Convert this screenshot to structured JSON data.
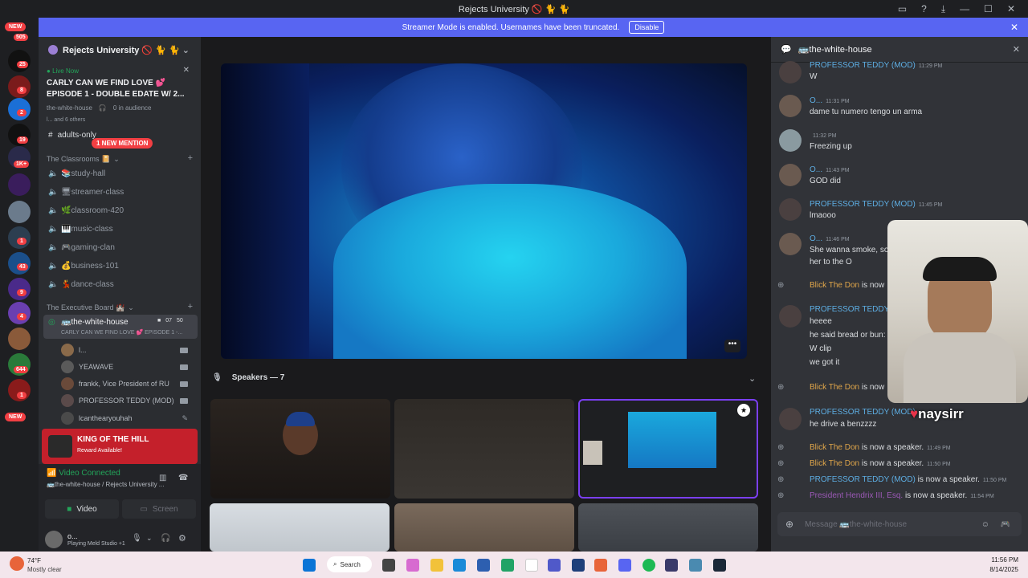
{
  "window": {
    "title": "Rejects University 🚫 🐈 🐈",
    "icons": [
      "inbox-icon",
      "help-icon",
      "download-icon",
      "minimize-icon",
      "maximize-icon",
      "close-icon"
    ]
  },
  "banner": {
    "text": "Streamer Mode is enabled. Usernames have been truncated.",
    "button": "Disable"
  },
  "rail": {
    "top_badge": "NEW",
    "top_count": "505",
    "badges": [
      "25",
      "8",
      "2",
      "19",
      "1K+",
      "1",
      "43",
      "9",
      "4",
      "644",
      "1"
    ],
    "bottom_badge": "NEW"
  },
  "sidebar": {
    "server_name": "Rejects University 🚫 🐈 🐈",
    "live": {
      "status": "Live Now",
      "title_line1": "CARLY CAN WE FIND LOVE 💕",
      "title_line2": "EPISODE 1 - DOUBLE EDATE W/ 2...",
      "channel": "the-white-house",
      "audience": "0 in audience",
      "others": "l... and 6 others"
    },
    "adults_channel": "adults-only",
    "mention_badge": "1 NEW MENTION",
    "category1": "The Classrooms 📔",
    "channels": [
      {
        "name": "📚study-hall"
      },
      {
        "name": "🖥streamer-class"
      },
      {
        "name": "🌿classroom-420"
      },
      {
        "name": "🎹music-class"
      },
      {
        "name": "🎮gaming-clan"
      },
      {
        "name": "💰business-101"
      },
      {
        "name": "💃dance-class"
      }
    ],
    "category2": "The Executive Board 🏰",
    "active_channel": {
      "name": "🚌the-white-house",
      "count": "07",
      "limit": "50",
      "subtitle": "CARLY CAN WE FIND LOVE 💕 EPISODE 1 -..."
    },
    "members": [
      {
        "name": "l..."
      },
      {
        "name": "YEAWAVE"
      },
      {
        "name": "frankk, Vice President of RU"
      },
      {
        "name": "PROFESSOR TEDDY (MOD)"
      },
      {
        "name": "lcanthearyouhah"
      }
    ],
    "reward": {
      "title": "KING OF THE HILL",
      "subtitle": "Reward Available!"
    },
    "voice": {
      "status": "Video Connected",
      "location": "🚌the-white-house / Rejects University ...",
      "video_btn": "Video",
      "screen_btn": "Screen"
    },
    "user": {
      "name": "o...",
      "activity": "Playing Meld Studio +1"
    }
  },
  "stage": {
    "speakers_label": "Speakers — 7",
    "more_icon": "more-icon"
  },
  "chat": {
    "channel": "🚌the-white-house",
    "messages": [
      {
        "author": "PROFESSOR TEDDY (MOD)",
        "time": "11:29 PM",
        "text": "W",
        "color": "#5dade2"
      },
      {
        "author": "O...",
        "time": "11:31 PM",
        "text": "dame tu numero tengo un arma",
        "color": "#5dade2"
      },
      {
        "author": "",
        "time": "11:32 PM",
        "text": "Freezing up",
        "color": "#7a59d8"
      },
      {
        "author": "O...",
        "time": "11:43 PM",
        "text": "GOD did",
        "color": "#5dade2"
      },
      {
        "author": "PROFESSOR TEDDY (MOD)",
        "time": "11:45 PM",
        "text": "lmaooo",
        "color": "#5dade2"
      },
      {
        "author": "O...",
        "time": "11:46 PM",
        "text": "She wanna smoke, so",
        "text2": "her to the O",
        "color": "#5dade2"
      }
    ],
    "system1": {
      "name": "Blick The Don",
      "text": "is now"
    },
    "teddy_block": {
      "author": "PROFESSOR TEDDY",
      "lines": [
        "heeee",
        "he said bread or bun:",
        "W clip",
        "we got it"
      ]
    },
    "system2": {
      "name": "Blick The Don",
      "text": "is now"
    },
    "teddy_block2": {
      "author": "PROFESSOR TEDDY (MOD)",
      "text": "he drive a benzzzz"
    },
    "speaker_events": [
      {
        "name": "Blick The Don",
        "text": "is now a speaker.",
        "time": "11:49 PM",
        "color": "#e0a64a"
      },
      {
        "name": "Blick The Don",
        "text": "is now a speaker.",
        "time": "11:50 PM",
        "color": "#e0a64a"
      },
      {
        "name": "PROFESSOR TEDDY (MOD)",
        "text": "is now a speaker.",
        "time": "11:50 PM",
        "color": "#5dade2"
      },
      {
        "name": "President Hendrix III, Esq.",
        "text": "is now a speaker.",
        "time": "11:54 PM",
        "color": "#9b59b6"
      }
    ],
    "input_placeholder": "Message 🚌the-white-house"
  },
  "webcam": {
    "name": "naysirr"
  },
  "taskbar": {
    "weather_temp": "74°F",
    "weather_desc": "Mostly clear",
    "search": "Search",
    "time": "11:56 PM",
    "date": "8/14/2025"
  },
  "colors": {
    "blurple": "#5865f2",
    "sidebar": "#2b2d31",
    "chat": "#313338",
    "red": "#f23f43",
    "mod_blue": "#5dade2",
    "speaker_gold": "#e0a64a"
  }
}
